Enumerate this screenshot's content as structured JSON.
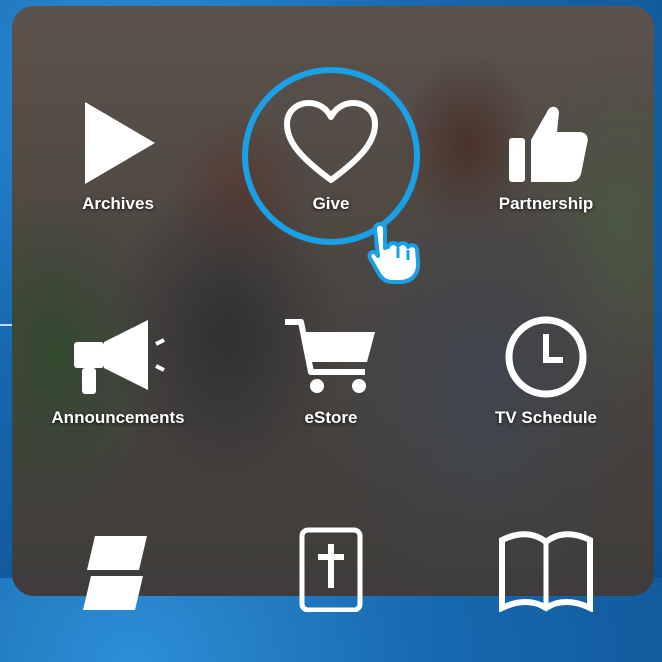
{
  "accent_color": "#1aa0e6",
  "menu": {
    "items": [
      {
        "label": "Archives",
        "icon": "play-icon"
      },
      {
        "label": "Give",
        "icon": "heart-icon",
        "highlighted": true
      },
      {
        "label": "Partnership",
        "icon": "thumbs-up-icon"
      },
      {
        "label": "Announcements",
        "icon": "megaphone-icon"
      },
      {
        "label": "eStore",
        "icon": "cart-icon"
      },
      {
        "label": "TV Schedule",
        "icon": "clock-icon"
      },
      {
        "label": "",
        "icon": "books-icon"
      },
      {
        "label": "",
        "icon": "bible-icon"
      },
      {
        "label": "",
        "icon": "open-book-icon"
      }
    ]
  }
}
